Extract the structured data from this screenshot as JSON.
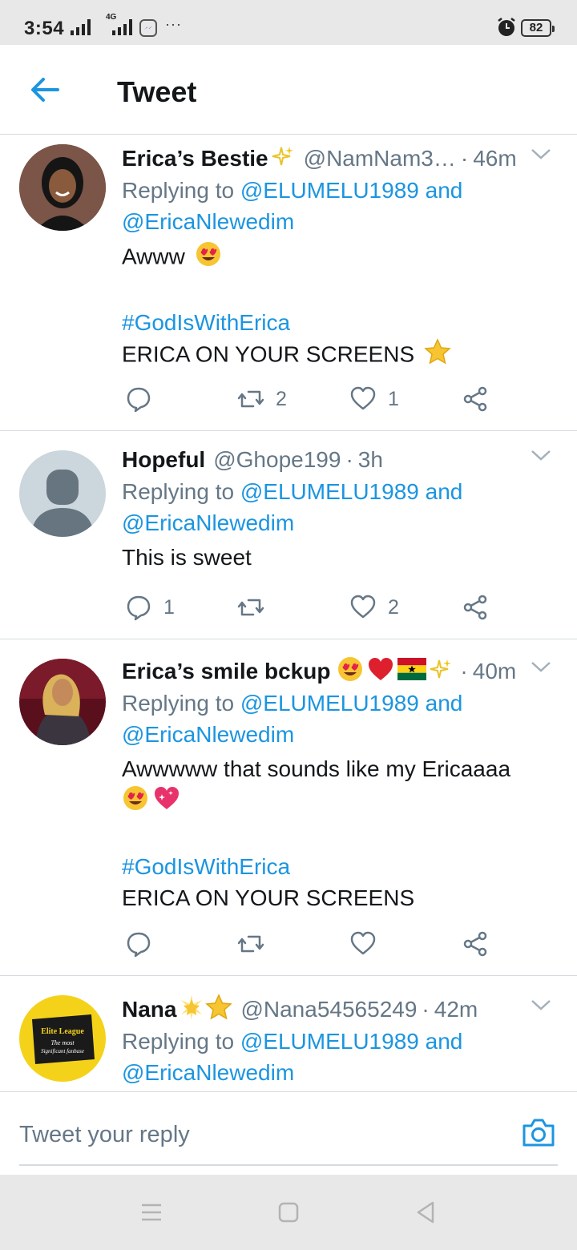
{
  "status_bar": {
    "time": "3:54",
    "network_label": "4G",
    "more": "···",
    "battery": "82"
  },
  "header": {
    "title": "Tweet"
  },
  "colors": {
    "accent": "#1b95e0",
    "secondary_text": "#657786",
    "primary_text": "#14171a",
    "divider": "#d6dbdf"
  },
  "tweets": [
    {
      "name": "Erica’s Bestie",
      "name_emojis": [
        "✨"
      ],
      "handle": "@NamNam3…",
      "time": "46m",
      "replying_prefix": "Replying to",
      "reply_to_1": "@ELUMELU1989",
      "reply_and": "and",
      "reply_to_2": "@EricaNlewedim",
      "line1": "Awww",
      "line1_emoji": "😍",
      "hashtag": "#GodIsWithErica",
      "line2": "ERICA ON YOUR SCREENS",
      "line2_emoji": "⭐",
      "replies": "",
      "retweets": "2",
      "likes": "1"
    },
    {
      "name": "Hopeful",
      "handle": "@Ghope199",
      "time": "3h",
      "replying_prefix": "Replying to",
      "reply_to_1": "@ELUMELU1989",
      "reply_and": "and",
      "reply_to_2": "@EricaNlewedim",
      "line1": "This is sweet",
      "replies": "1",
      "retweets": "",
      "likes": "2"
    },
    {
      "name": "Erica’s smile bckup",
      "name_emojis": [
        "😍",
        "❤️",
        "🇬🇭",
        "✨"
      ],
      "handle": "",
      "time": "40m",
      "replying_prefix": "Replying to",
      "reply_to_1": "@ELUMELU1989",
      "reply_and": "and",
      "reply_to_2": "@EricaNlewedim",
      "line1": "Awwwww that sounds like my Ericaaaa",
      "line1_emojis": [
        "😍",
        "💖"
      ],
      "hashtag": "#GodIsWithErica",
      "line2": "ERICA ON YOUR SCREENS",
      "replies": "",
      "retweets": "",
      "likes": ""
    },
    {
      "name": "Nana",
      "name_emojis": [
        "🌟",
        "⭐"
      ],
      "handle": "@Nana54565249",
      "time": "42m",
      "replying_prefix": "Replying to",
      "reply_to_1": "@ELUMELU1989",
      "reply_and": "and",
      "reply_to_2": "@EricaNlewedim",
      "avatar_text_1": "Elite League",
      "avatar_text_2": "The most",
      "avatar_text_3": "Significant fanbase"
    }
  ],
  "composer": {
    "placeholder": "Tweet your reply"
  },
  "icons": {
    "back": "arrow-left-icon",
    "caret": "chevron-down-icon",
    "reply": "reply-icon",
    "retweet": "retweet-icon",
    "like": "heart-icon",
    "share": "share-icon",
    "camera": "camera-icon"
  }
}
